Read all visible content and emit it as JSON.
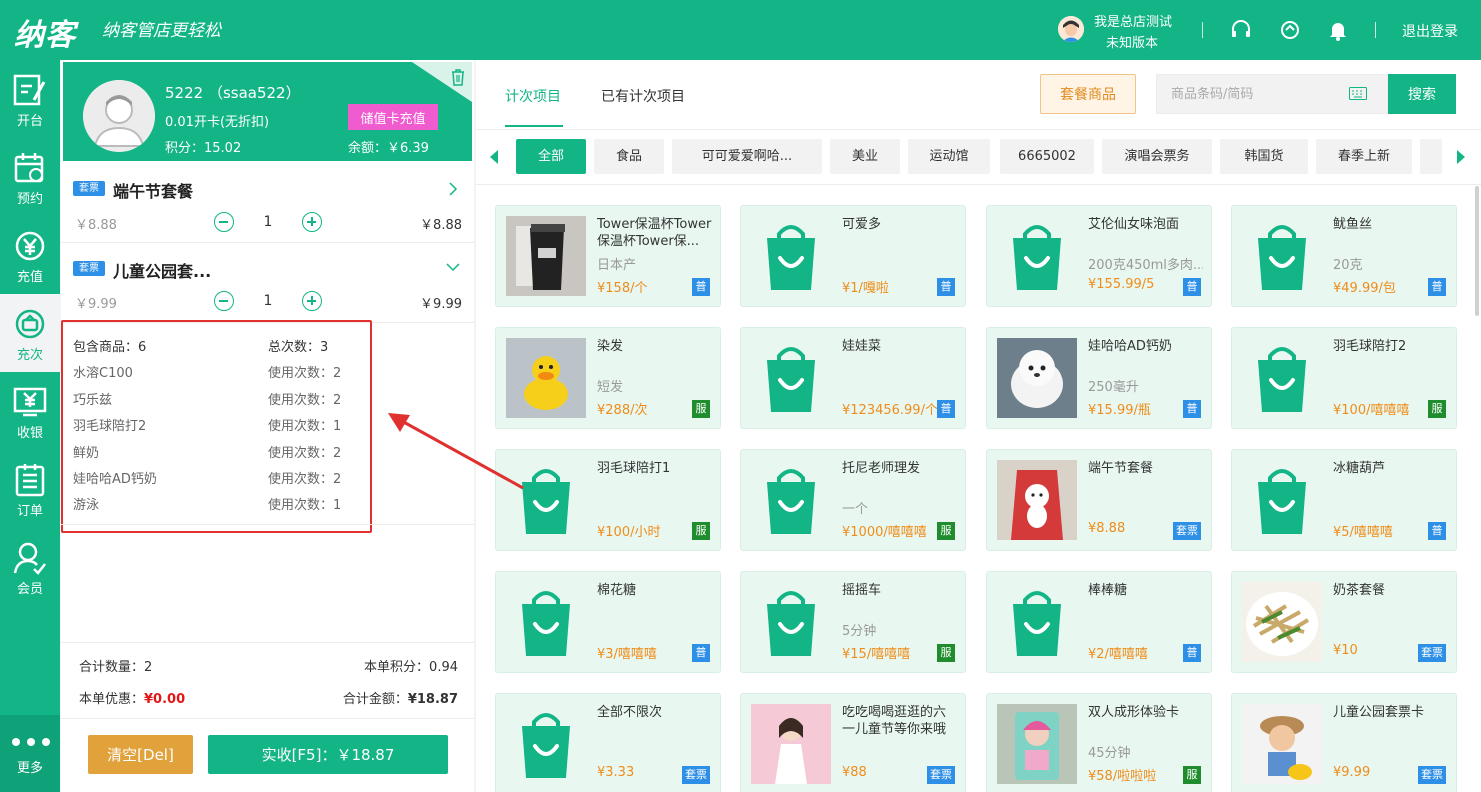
{
  "header": {
    "logo": "纳客",
    "slogan": "纳客管店更轻松",
    "user_name": "我是总店测试",
    "user_version": "未知版本",
    "logout": "退出登录"
  },
  "nav": [
    {
      "label": "开台",
      "icon": "edit-icon"
    },
    {
      "label": "预约",
      "icon": "calendar-icon"
    },
    {
      "label": "充值",
      "icon": "recharge-icon"
    },
    {
      "label": "充次",
      "icon": "count-icon"
    },
    {
      "label": "收银",
      "icon": "cashier-icon"
    },
    {
      "label": "订单",
      "icon": "order-icon"
    },
    {
      "label": "会员",
      "icon": "member-icon"
    },
    {
      "label": "更多",
      "icon": "more-icon"
    }
  ],
  "member": {
    "name": "5222 （ssaa522）",
    "card_type": "0.01开卡(无折扣)",
    "points": "积分：15.02",
    "recharge_button": "储值卡充值",
    "balance": "余额：￥6.39"
  },
  "cart_items": [
    {
      "tag": "套票",
      "title": "端午节套餐",
      "orig_price": "￥8.88",
      "qty": "1",
      "total": "￥8.88"
    },
    {
      "tag": "套票",
      "title": "儿童公园套...",
      "orig_price": "￥9.99",
      "qty": "1",
      "total": "￥9.99"
    }
  ],
  "package_detail": {
    "included_label": "包含商品：6",
    "total_count_label": "总次数：3",
    "items": [
      {
        "name": "水溶C100",
        "count": "使用次数：2"
      },
      {
        "name": "巧乐兹",
        "count": "使用次数：2"
      },
      {
        "name": "羽毛球陪打2",
        "count": "使用次数：1"
      },
      {
        "name": "鲜奶",
        "count": "使用次数：2"
      },
      {
        "name": "娃哈哈AD钙奶",
        "count": "使用次数：2"
      },
      {
        "name": "游泳",
        "count": "使用次数：1"
      }
    ]
  },
  "summary": {
    "total_qty": "合计数量：2",
    "points": "本单积分：0.94",
    "discount_label": "本单优惠：",
    "discount_value": "¥0.00",
    "amount_label": "合计金额：",
    "amount_value": "¥18.87",
    "clear_button": "清空[Del]",
    "pay_button": "实收[F5]：￥18.87"
  },
  "tabs": [
    "计次项目",
    "已有计次项目"
  ],
  "combo_button": "套餐商品",
  "search": {
    "placeholder": "商品条码/简码",
    "button": "搜索"
  },
  "categories": [
    "全部",
    "食品",
    "可可爱爱啊哈...",
    "美业",
    "运动馆",
    "6665002",
    "演唱会票务",
    "韩国货",
    "春季上新"
  ],
  "products": [
    {
      "name": "Tower保温杯Tower保温杯Tower保...",
      "spec": "日本产",
      "price": "¥158/个",
      "badge": "普",
      "thumb": "cup"
    },
    {
      "name": "可爱多",
      "spec": "",
      "price": "¥1/嘎啦",
      "badge": "普",
      "thumb": "bag"
    },
    {
      "name": "艾伦仙女味泡面",
      "spec": "200克450ml多肉...",
      "price": "¥155.99/5",
      "badge": "普",
      "thumb": "bag"
    },
    {
      "name": "鱿鱼丝",
      "spec": "20克",
      "price": "¥49.99/包",
      "badge": "普",
      "thumb": "bag"
    },
    {
      "name": "染发",
      "spec": "短发",
      "price": "¥288/次",
      "badge": "服",
      "thumb": "duck"
    },
    {
      "name": "娃娃菜",
      "spec": "",
      "price": "¥123456.99/个",
      "badge": "普",
      "thumb": "bag"
    },
    {
      "name": "娃哈哈AD钙奶",
      "spec": "250毫升",
      "price": "¥15.99/瓶",
      "badge": "普",
      "thumb": "dog"
    },
    {
      "name": "羽毛球陪打2",
      "spec": "",
      "price": "¥100/嘻嘻嘻",
      "badge": "服",
      "thumb": "bag"
    },
    {
      "name": "羽毛球陪打1",
      "spec": "",
      "price": "¥100/小时",
      "badge": "服",
      "thumb": "bag"
    },
    {
      "name": "托尼老师理发",
      "spec": "一个",
      "price": "¥1000/嘻嘻嘻",
      "badge": "服",
      "thumb": "bag"
    },
    {
      "name": "端午节套餐",
      "spec": "",
      "price": "¥8.88",
      "badge": "套票",
      "thumb": "plush"
    },
    {
      "name": "冰糖葫芦",
      "spec": "",
      "price": "¥5/嘻嘻嘻",
      "badge": "普",
      "thumb": "bag"
    },
    {
      "name": "棉花糖",
      "spec": "",
      "price": "¥3/嘻嘻嘻",
      "badge": "普",
      "thumb": "bag"
    },
    {
      "name": "摇摇车",
      "spec": "5分钟",
      "price": "¥15/嘻嘻嘻",
      "badge": "服",
      "thumb": "bag"
    },
    {
      "name": "棒棒糖",
      "spec": "",
      "price": "¥2/嘻嘻嘻",
      "badge": "普",
      "thumb": "bag"
    },
    {
      "name": "奶茶套餐",
      "spec": "",
      "price": "¥10",
      "badge": "套票",
      "thumb": "food"
    },
    {
      "name": "全部不限次",
      "spec": "",
      "price": "¥3.33",
      "badge": "套票",
      "thumb": "bag"
    },
    {
      "name": "吃吃喝喝逛逛的六一儿童节等你来哦",
      "spec": "",
      "price": "¥88",
      "badge": "套票",
      "thumb": "girl"
    },
    {
      "name": "双人成形体验卡",
      "spec": "45分钟",
      "price": "¥58/啦啦啦",
      "badge": "服",
      "thumb": "toy"
    },
    {
      "name": "儿童公园套票卡",
      "spec": "",
      "price": "¥9.99",
      "badge": "套票",
      "thumb": "kid"
    }
  ]
}
